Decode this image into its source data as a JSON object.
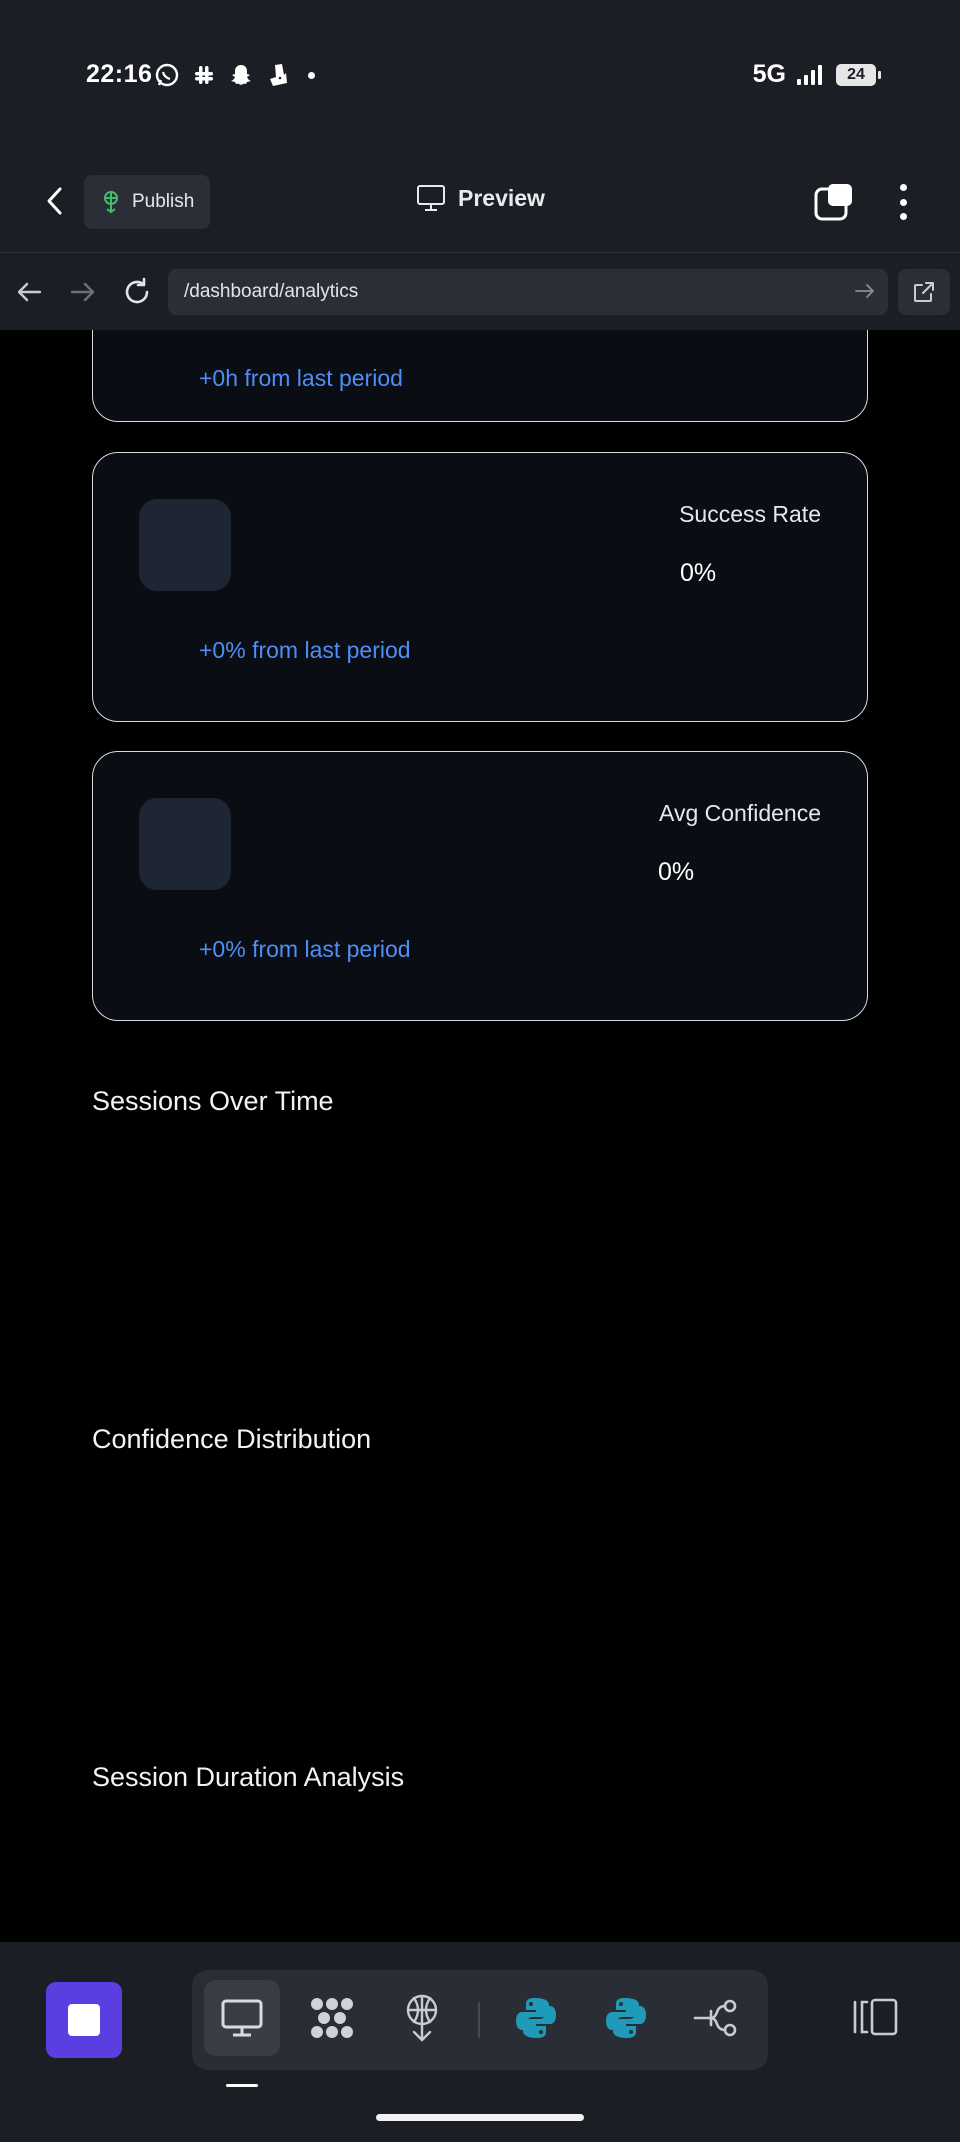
{
  "status_bar": {
    "time": "22:16",
    "network": "5G",
    "battery": "24",
    "notification_icons": [
      "whatsapp-icon",
      "slack-icon",
      "snapchat-icon",
      "deliveroo-icon"
    ]
  },
  "toolbar": {
    "publish_label": "Publish",
    "preview_label": "Preview"
  },
  "url_bar": {
    "url": "/dashboard/analytics"
  },
  "stat_cards": [
    {
      "label": "",
      "value": "",
      "change": "+0h from last period"
    },
    {
      "label": "Success Rate",
      "value": "0%",
      "change": "+0% from last period"
    },
    {
      "label": "Avg Confidence",
      "value": "0%",
      "change": "+0% from last period"
    }
  ],
  "sections": [
    {
      "title": "Sessions Over Time"
    },
    {
      "title": "Confidence Distribution"
    },
    {
      "title": "Session Duration Analysis"
    }
  ],
  "dock": {
    "tools": [
      "desktop-icon",
      "grid-dots-icon",
      "antenna-icon",
      "python-icon",
      "python-icon",
      "connection-icon"
    ],
    "active_tool": "desktop-icon"
  },
  "colors": {
    "accent": "#5b3ee0",
    "link": "#4f8ef5",
    "python": "#1f9ab8",
    "chrome": "#1c1e25"
  }
}
